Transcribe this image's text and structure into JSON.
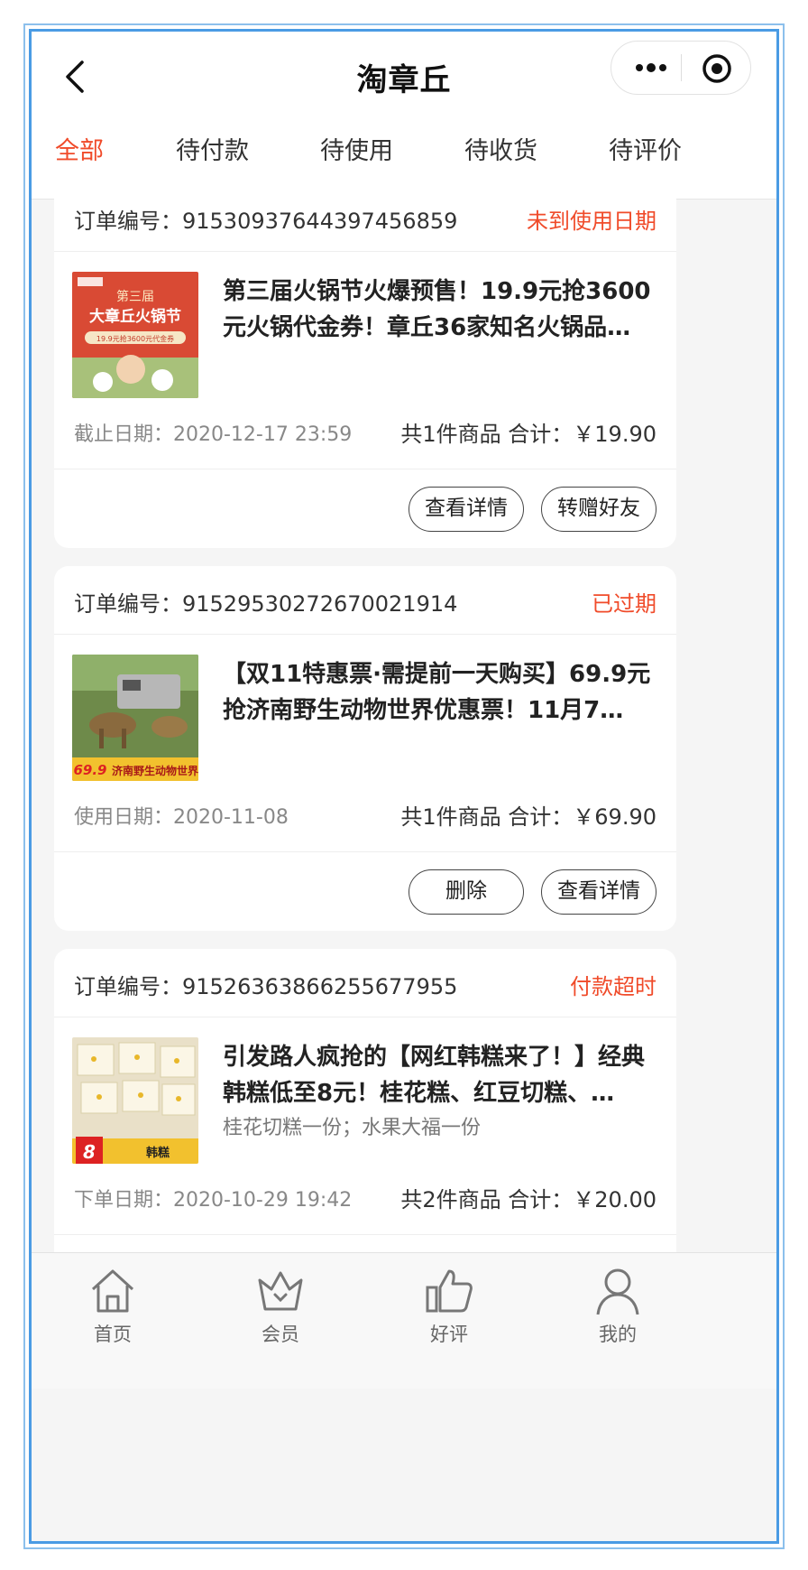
{
  "header": {
    "title": "淘章丘"
  },
  "tabs": [
    {
      "label": "全部"
    },
    {
      "label": "待付款"
    },
    {
      "label": "待使用"
    },
    {
      "label": "待收货"
    },
    {
      "label": "待评价"
    }
  ],
  "orders": [
    {
      "order_no": "订单编号：91530937644397456859",
      "status": "未到使用日期",
      "thumb_text": [
        "第三届",
        "大章丘火锅节",
        "19.9元抢3600元代金券"
      ],
      "title": "第三届火锅节火爆预售！19.9元抢3600元火锅代金券！章丘36家知名火锅品…",
      "date": "截止日期：2020-12-17 23:59",
      "summary": "共1件商品 合计：￥19.90",
      "buttons": [
        "查看详情",
        "转赠好友"
      ]
    },
    {
      "order_no": "订单编号：91529530272670021914",
      "status": "已过期",
      "thumb_text": [
        "69.9",
        "济南野生动物世界"
      ],
      "title": "【双11特惠票·需提前一天购买】69.9元抢济南野生动物世界优惠票！11月7…",
      "date": "使用日期：2020-11-08",
      "summary": "共1件商品 合计：￥69.90",
      "buttons": [
        "删除",
        "查看详情"
      ]
    },
    {
      "order_no": "订单编号：91526363866255677955",
      "status": "付款超时",
      "thumb_text": [
        "8",
        "韩糕"
      ],
      "title": "引发路人疯抢的【网红韩糕来了！】经典韩糕低至8元！桂花糕、红豆切糕、…",
      "spec": "桂花切糕一份；水果大福一份",
      "date": "下单日期：2020-10-29 19:42",
      "summary": "共2件商品 合计：￥20.00"
    }
  ],
  "tabbar": [
    {
      "label": "首页",
      "icon": "home-icon"
    },
    {
      "label": "会员",
      "icon": "crown-icon"
    },
    {
      "label": "好评",
      "icon": "thumbs-up-icon"
    },
    {
      "label": "我的",
      "icon": "user-icon"
    }
  ],
  "colors": {
    "accent": "#f04b2a",
    "frame": "#4a9be4",
    "background": "#f5f5f5"
  }
}
